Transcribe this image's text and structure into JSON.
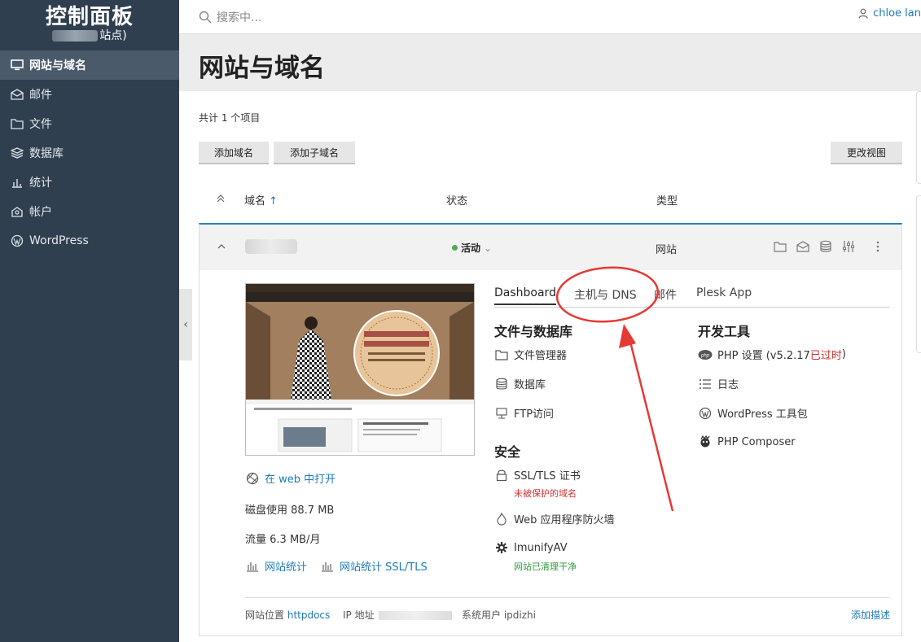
{
  "sidebar": {
    "brand_title": "控制面板",
    "brand_sub_suffix": "站点)",
    "items": [
      {
        "label": "网站与域名",
        "icon": "monitor-icon",
        "active": true
      },
      {
        "label": "邮件",
        "icon": "mail-icon",
        "active": false
      },
      {
        "label": "文件",
        "icon": "folder-icon",
        "active": false
      },
      {
        "label": "数据库",
        "icon": "database-icon",
        "active": false
      },
      {
        "label": "统计",
        "icon": "chart-icon",
        "active": false
      },
      {
        "label": "帐户",
        "icon": "account-icon",
        "active": false
      },
      {
        "label": "WordPress",
        "icon": "wordpress-icon",
        "active": false
      }
    ],
    "collapse_glyph": "‹"
  },
  "topbar": {
    "search_placeholder": "搜索中...",
    "user_name": "chloe lan"
  },
  "page": {
    "title": "网站与域名",
    "item_count": "共计 1 个项目",
    "add_domain": "添加域名",
    "add_subdomain": "添加子域名",
    "change_view": "更改视图"
  },
  "table": {
    "col_domain": "域名",
    "sort_arrow": "↑",
    "col_status": "状态",
    "col_type": "类型"
  },
  "domain_row": {
    "status": "活动",
    "type": "网站"
  },
  "details": {
    "open_in_web": "在 web 中打开",
    "disk_usage": "磁盘使用 88.7 MB",
    "traffic": "流量 6.3 MB/月",
    "stats": "网站统计",
    "stats_ssl": "网站统计 SSL/TLS"
  },
  "tabs": [
    "Dashboard",
    "主机与 DNS",
    "邮件",
    "Plesk App"
  ],
  "files_db": {
    "title": "文件与数据库",
    "file_manager": "文件管理器",
    "databases": "数据库",
    "ftp": "FTP访问"
  },
  "security": {
    "title": "安全",
    "ssl": "SSL/TLS 证书",
    "ssl_sub": "未被保护的域名",
    "waf": "Web 应用程序防火墙",
    "imunify": "ImunifyAV",
    "imunify_sub": "网站已清理干净"
  },
  "devtools": {
    "title": "开发工具",
    "php_settings": "PHP 设置 (v5.2.17 ",
    "php_outdated": "已过时",
    "php_close": ")",
    "logs": "日志",
    "wp_toolkit": "WordPress 工具包",
    "composer": "PHP Composer"
  },
  "footer": {
    "location_label": "网站位置",
    "location_value": "httpdocs",
    "ip_label": "IP 地址",
    "sys_user": "系统用户 ipdizhi",
    "add_desc": "添加描述"
  },
  "colors": {
    "sidebar_bg": "#2f3f4f",
    "accent_blue": "#1e7ab8",
    "annotation_red": "#e53935",
    "status_green": "#4caf50"
  }
}
